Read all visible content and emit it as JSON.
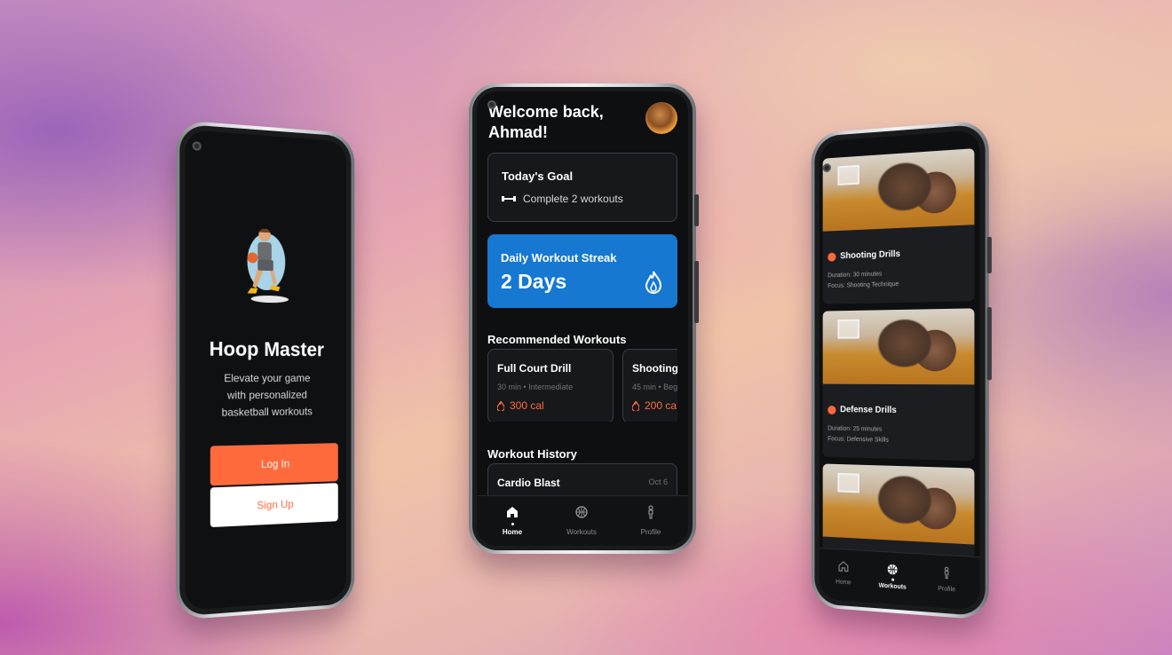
{
  "left_screen": {
    "app_title": "Hoop Master",
    "tagline": "Elevate your game with personalized basketball workouts",
    "login_label": "Log In",
    "signup_label": "Sign Up"
  },
  "home_screen": {
    "greeting": "Welcome back, Ahmad!",
    "goal": {
      "title": "Today's Goal",
      "text": "Complete 2 workouts"
    },
    "streak": {
      "label": "Daily Workout Streak",
      "value": "2 Days"
    },
    "recommended_title": "Recommended Workouts",
    "recommended": [
      {
        "name": "Full Court Drill",
        "meta": "30 min • Intermediate",
        "calories": "300 cal"
      },
      {
        "name": "Shooting",
        "meta": "45 min • Beg",
        "calories": "200 ca"
      }
    ],
    "history_title": "Workout History",
    "history": [
      {
        "name": "Cardio Blast",
        "date": "Oct 6"
      }
    ],
    "tabs": [
      {
        "label": "Home",
        "icon": "home-icon"
      },
      {
        "label": "Workouts",
        "icon": "basketball-icon"
      },
      {
        "label": "Profile",
        "icon": "person-icon"
      }
    ]
  },
  "workouts_screen": {
    "drills": [
      {
        "title": "Shooting Drills",
        "duration": "Duration: 30 minutes",
        "focus": "Focus: Shooting Technique"
      },
      {
        "title": "Defense Drills",
        "duration": "Duration: 25 minutes",
        "focus": "Focus: Defensive Skills"
      },
      {
        "title": "",
        "duration": "",
        "focus": ""
      }
    ],
    "tabs": [
      {
        "label": "Home",
        "icon": "home-icon"
      },
      {
        "label": "Workouts",
        "icon": "basketball-icon"
      },
      {
        "label": "Profile",
        "icon": "person-icon"
      }
    ]
  },
  "colors": {
    "accent_orange": "#ff6a3d",
    "streak_blue": "#1678d1",
    "screen_bg": "#0f1012"
  }
}
